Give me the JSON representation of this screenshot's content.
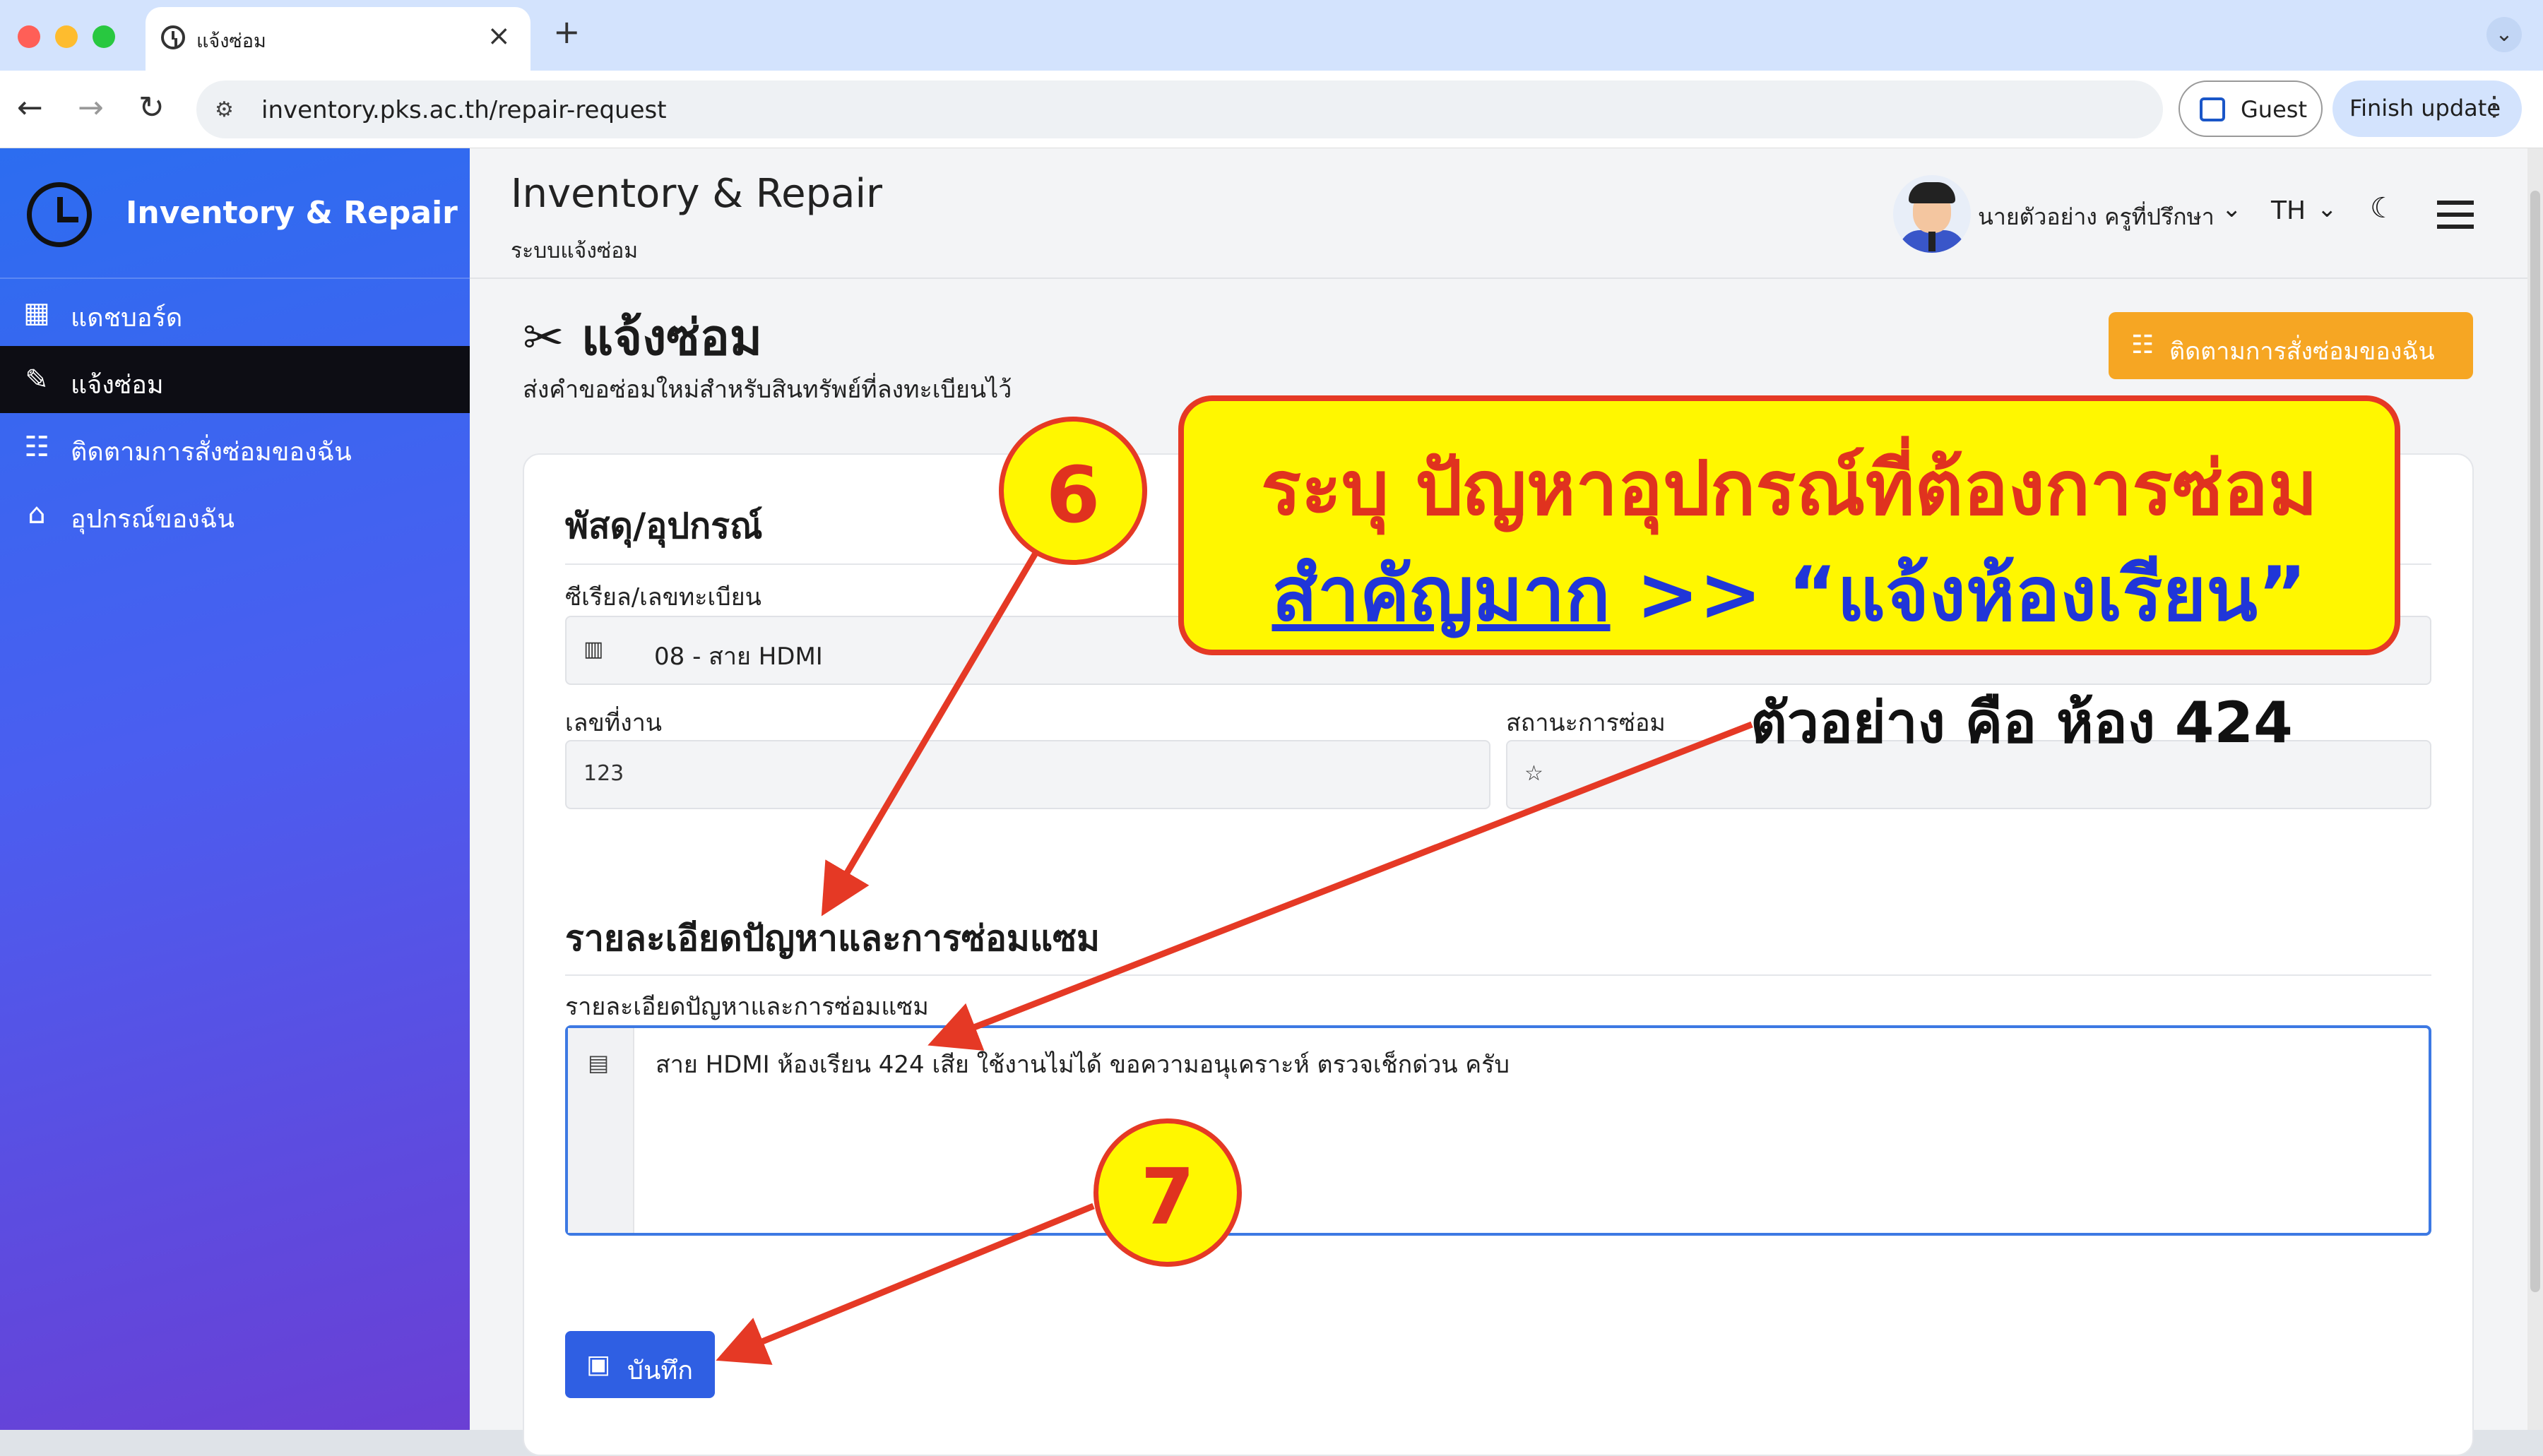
{
  "browser": {
    "tab_title": "แจ้งซ่อม",
    "tab_close": "×",
    "new_tab": "+",
    "tab_menu": "⌄",
    "url": "inventory.pks.ac.th/repair-request",
    "guest_label": "Guest",
    "finish_update_label": "Finish update",
    "menu_dots": "⋮",
    "back": "←",
    "forward": "→",
    "reload": "↻"
  },
  "sidebar": {
    "brand": "Inventory & Repair",
    "items": [
      {
        "label": "แดชบอร์ด",
        "icon": "dashboard-icon",
        "active": false
      },
      {
        "label": "แจ้งซ่อม",
        "icon": "repair-icon",
        "active": true
      },
      {
        "label": "ติดตามการสั่งซ่อมของฉัน",
        "icon": "checklist-icon",
        "active": false
      },
      {
        "label": "อุปกรณ์ของฉัน",
        "icon": "store-icon",
        "active": false
      }
    ]
  },
  "header": {
    "title": "Inventory & Repair",
    "subtitle": "ระบบแจ้งซ่อม",
    "user_name": "นายตัวอย่าง ครูที่ปรึกษา",
    "language": "TH"
  },
  "page": {
    "title": "แจ้งซ่อม",
    "description": "ส่งคำขอซ่อมใหม่สำหรับสินทรัพย์ที่ลงทะเบียนไว้",
    "track_button": "ติดตามการสั่งซ่อมของฉัน"
  },
  "form": {
    "section_equipment": "พัสดุ/อุปกรณ์",
    "serial_label": "ซีเรียล/เลขทะเบียน",
    "serial_value": "08 - สาย HDMI",
    "job_number_label": "เลขที่งาน",
    "job_number_value": "",
    "status_label": "สถานะการซ่อม",
    "status_value": "",
    "section_details": "รายละเอียดปัญหาและการซ่อมแซม",
    "details_label": "รายละเอียดปัญหาและการซ่อมแซม",
    "details_value": "สาย HDMI ห้องเรียน 424 เสีย ใช้งานไม่ได้ ขอความอนุเคราะห์ ตรวจเช็กด่วน ครับ",
    "save_button": "บันทึก"
  },
  "annotation": {
    "headline": "ระบุ ปัญหาอุปกรณ์ที่ต้องการซ่อม",
    "emphasis": "สำคัญมาก",
    "arrow_text": ">>",
    "instruction": "“แจ้งห้องเรียน”",
    "example": "ตัวอย่าง คือ ห้อง 424",
    "step_6": "6",
    "step_7": "7",
    "arrow_color": "#e53925",
    "highlight_color": "#fff700"
  },
  "colors": {
    "primary": "#2f5fe3",
    "warning": "#f6a623",
    "sidebar_active": "#0d0d14"
  }
}
